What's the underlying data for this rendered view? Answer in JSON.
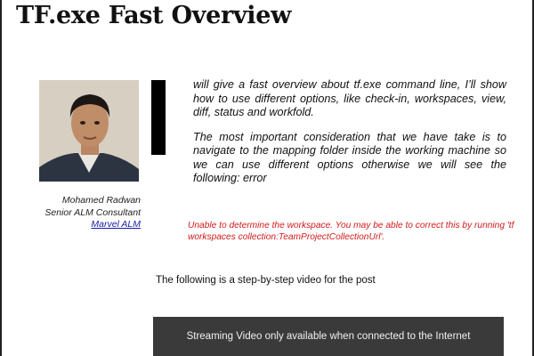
{
  "post": {
    "title": "TF.exe Fast Overview",
    "paragraph1": "will give a fast overview about tf.exe command line, I’ll show how to use different options, like check-in, workspaces, view, diff, status and workfold.",
    "paragraph2": "The most important consideration that we have take is to navigate to the mapping folder inside the working machine so we can use different options otherwise we will see the following: error",
    "error_message": "Unable to determine the workspace. You may be able to correct this by running 'tf workspaces collection:TeamProjectCollectionUrl'.",
    "video_intro": "The following is a step-by-step video for the post",
    "video_placeholder": "Streaming Video only available when connected to the Internet"
  },
  "author": {
    "name": "Mohamed Radwan",
    "role": "Senior ALM Consultant",
    "company_link": "Marvel ALM"
  },
  "colors": {
    "error_text": "#d11a1a",
    "link": "#1a1aa6",
    "video_bg": "#3a3a3a"
  }
}
